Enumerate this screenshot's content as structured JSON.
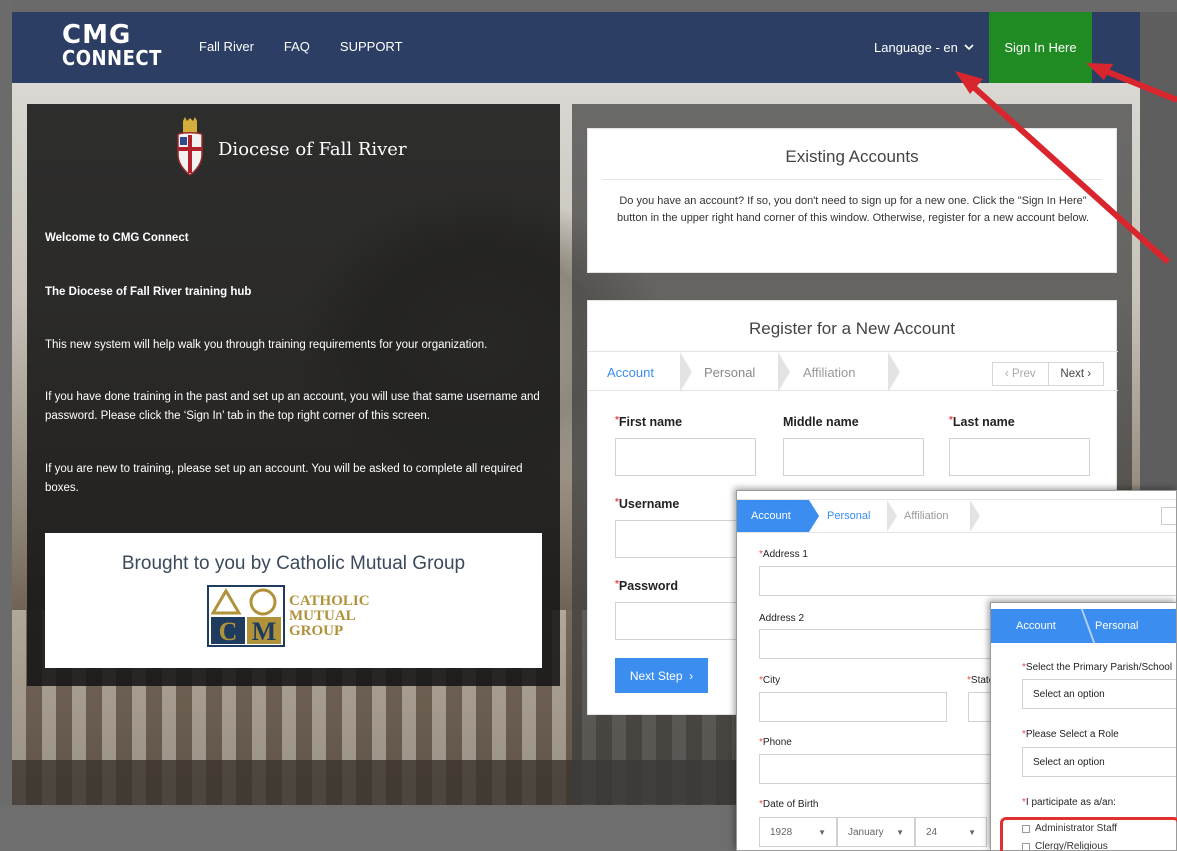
{
  "navbar": {
    "logo_top": "CMG",
    "logo_bottom": "CONNECT",
    "links": [
      "Fall River",
      "FAQ",
      "SUPPORT"
    ],
    "language": "Language - en",
    "sign_in": "Sign In Here"
  },
  "left_panel": {
    "diocese_name": "Diocese of Fall River",
    "welcome": "Welcome to CMG Connect",
    "hub": "The Diocese of Fall River training hub",
    "para1": "This new system will help walk you through training requirements for your organization.",
    "para2": "If you have done training in the past and set up an account, you will use that same username and password.  Please click the ‘Sign In’ tab in the top right corner of this screen.",
    "para3": "If you are new to training, please set up an account.  You will be asked to complete all required boxes.",
    "brought_by": "Brought to you by Catholic Mutual Group",
    "cmg_words": [
      "CATHOLIC",
      "MUTUAL",
      "GROUP"
    ]
  },
  "existing": {
    "title": "Existing Accounts",
    "body": "Do you have an account? If so, you don't need to sign up for a new one. Click the \"Sign In Here\" button in the upper right hand corner of this window. Otherwise, register for a new account below."
  },
  "register": {
    "title": "Register for a New Account",
    "steps": [
      "Account",
      "Personal",
      "Affiliation"
    ],
    "prev": "Prev",
    "next": "Next",
    "first_name": "First name",
    "middle_name": "Middle name",
    "last_name": "Last name",
    "username": "Username",
    "password": "Password",
    "next_step": "Next Step"
  },
  "overlay1": {
    "steps": [
      "Account",
      "Personal",
      "Affiliation"
    ],
    "address1": "Address 1",
    "address2": "Address 2",
    "city": "City",
    "state": "State",
    "phone": "Phone",
    "dob": "Date of Birth",
    "dob_year": "1928",
    "dob_month": "January",
    "dob_day": "24"
  },
  "overlay2": {
    "steps": [
      "Account",
      "Personal"
    ],
    "primary_parish": "Select the Primary Parish/School",
    "select_option_1": "Select an option",
    "role": "Please Select a Role",
    "select_option_2": "Select an option",
    "participate": "I participate as a/an:",
    "options": [
      "Administrator Staff",
      "Clergy/Religious"
    ]
  },
  "colors": {
    "navbar": "#2c3e63",
    "sign_in": "#1f8b22",
    "accent_blue": "#3b8ef0",
    "arrow_red": "#d9262e"
  }
}
